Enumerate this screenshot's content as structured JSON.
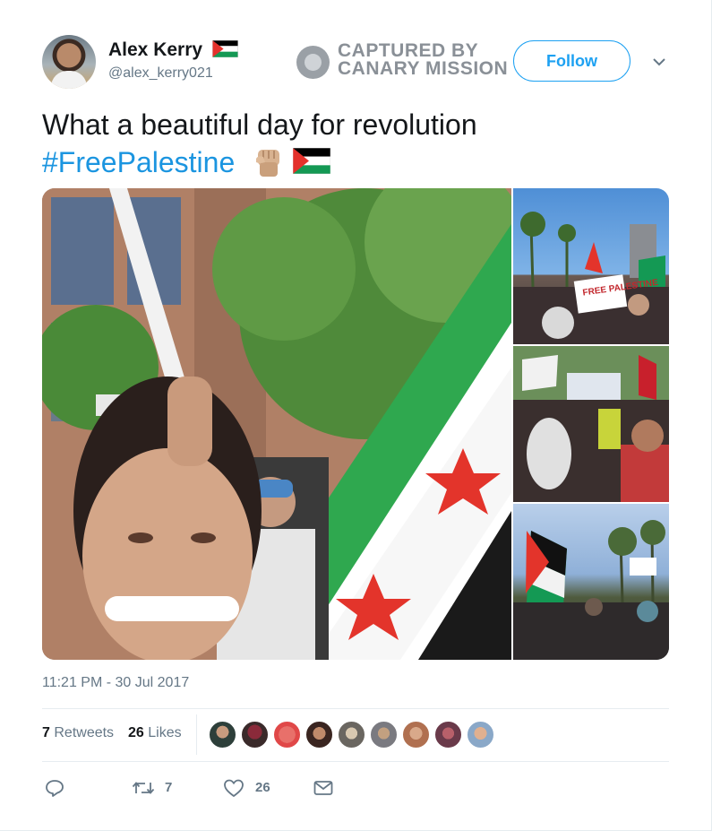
{
  "user": {
    "name": "Alex Kerry",
    "handle": "@alex_kerry021"
  },
  "watermark": {
    "line1": "CAPTURED BY",
    "line2": "CANARY MISSION"
  },
  "follow_label": "Follow",
  "tweet": {
    "text": "What a beautiful day for revolution",
    "hashtag": "#FreePalestine"
  },
  "timestamp": "11:21 PM - 30 Jul 2017",
  "stats": {
    "retweets_count": "7",
    "retweets_label": "Retweets",
    "likes_count": "26",
    "likes_label": "Likes"
  },
  "actions": {
    "retweet_count": "7",
    "like_count": "26"
  },
  "media": {
    "side_sign_text": "FREE PALESTINE"
  },
  "colors": {
    "accent": "#1da1f2",
    "hashtag": "#1b95e0",
    "muted": "#657786",
    "flag_black": "#000000",
    "flag_white": "#ffffff",
    "flag_green": "#149954",
    "flag_red": "#e4312b"
  },
  "icons": [
    "palestine-flag-icon",
    "raised-fist-icon",
    "caret-down-icon",
    "reply-icon",
    "retweet-icon",
    "heart-icon",
    "direct-message-icon"
  ]
}
